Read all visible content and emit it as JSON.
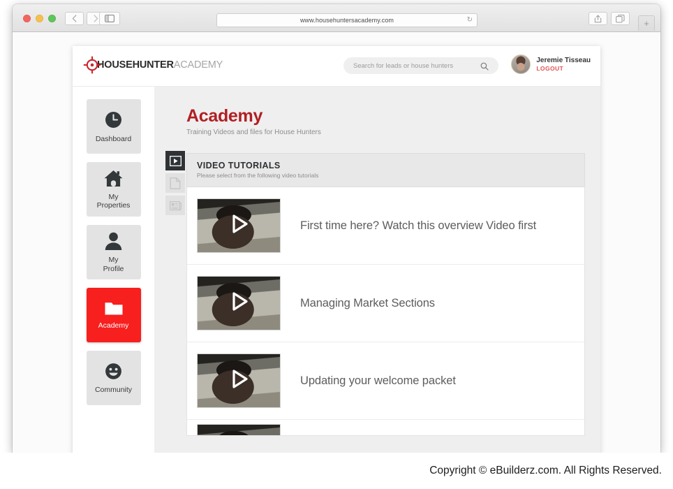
{
  "browser": {
    "url": "www.househuntersacademy.com",
    "back_label": "‹",
    "forward_label": "›",
    "reload_label": "↻",
    "newtab_label": "+",
    "icons": {
      "sidebar": "sidebar-toggle-icon",
      "share": "share-icon",
      "tabs": "tabs-overview-icon"
    }
  },
  "header": {
    "logo": {
      "bold": "HOUSEHUNTER",
      "light": "ACADEMY"
    },
    "search": {
      "placeholder": "Search for leads or house hunters",
      "value": ""
    },
    "user": {
      "name": "Jeremie Tisseau",
      "logout": "LOGOUT"
    }
  },
  "sidebar": {
    "items": [
      {
        "label": "Dashboard",
        "icon": "clock-icon",
        "active": false
      },
      {
        "label": "My\nProperties",
        "icon": "house-icon",
        "active": false
      },
      {
        "label": "My\nProfile",
        "icon": "person-icon",
        "active": false
      },
      {
        "label": "Academy",
        "icon": "folder-icon",
        "active": true
      },
      {
        "label": "Community",
        "icon": "smiley-icon",
        "active": false
      }
    ],
    "labels": {
      "dashboard": "Dashboard",
      "my_properties_line1": "My",
      "my_properties_line2": "Properties",
      "my_profile_line1": "My",
      "my_profile_line2": "Profile",
      "academy": "Academy",
      "community": "Community"
    }
  },
  "main": {
    "title": "Academy",
    "subtitle": "Training Videos and files for House Hunters",
    "vertical_tabs": [
      {
        "icon": "play-video-icon",
        "active": true
      },
      {
        "icon": "document-icon",
        "active": false
      },
      {
        "icon": "article-icon",
        "active": false
      }
    ],
    "panel": {
      "title": "VIDEO TUTORIALS",
      "subtitle": "Please select from the following video tutorials"
    },
    "videos": [
      {
        "title": "First time here? Watch this overview Video first"
      },
      {
        "title": "Managing Market Sections"
      },
      {
        "title": "Updating your welcome packet"
      }
    ]
  },
  "footer": {
    "copyright": "Copyright © eBuilderz.com. All Rights Reserved."
  },
  "colors": {
    "accent_red": "#f81f1f",
    "title_red": "#b01f24",
    "logout_red": "#e0534e",
    "panel_gray": "#e9e8e8",
    "content_gray": "#f0efef",
    "dark_tab": "#2f3335"
  }
}
